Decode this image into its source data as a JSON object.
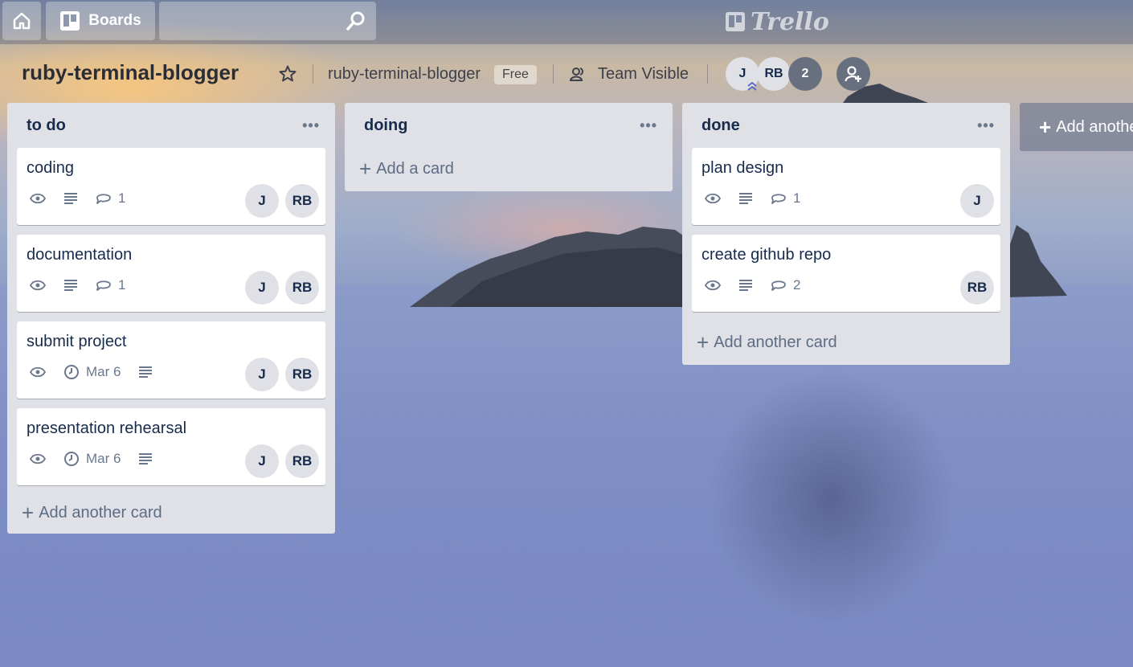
{
  "header": {
    "boards_label": "Boards",
    "search_placeholder": "",
    "logo_text": "Trello"
  },
  "board": {
    "title": "ruby-terminal-blogger",
    "team_name": "ruby-terminal-blogger",
    "plan_badge": "Free",
    "visibility": "Team Visible",
    "members": [
      "J",
      "RB"
    ],
    "extra_member_count": "2"
  },
  "lists": [
    {
      "title": "to do",
      "menu": "•••",
      "cards": [
        {
          "title": "coding",
          "comments": "1",
          "members": [
            "J",
            "RB"
          ]
        },
        {
          "title": "documentation",
          "comments": "1",
          "members": [
            "J",
            "RB"
          ]
        },
        {
          "title": "submit project",
          "due": "Mar 6",
          "members": [
            "J",
            "RB"
          ]
        },
        {
          "title": "presentation rehearsal",
          "due": "Mar 6",
          "members": [
            "J",
            "RB"
          ]
        }
      ],
      "add_label": "Add another card"
    },
    {
      "title": "doing",
      "menu": "•••",
      "cards": [],
      "add_label": "Add a card"
    },
    {
      "title": "done",
      "menu": "•••",
      "cards": [
        {
          "title": "plan design",
          "comments": "1",
          "members": [
            "J"
          ]
        },
        {
          "title": "create github repo",
          "comments": "2",
          "members": [
            "RB"
          ]
        }
      ],
      "add_label": "Add another card"
    }
  ],
  "add_list_label": "Add another list",
  "icons": {
    "home": "home-icon",
    "boards": "boards-icon",
    "search": "search-icon",
    "star": "star-icon",
    "visibility": "team-icon",
    "watch": "eye-icon",
    "description": "description-icon",
    "comment": "comment-icon",
    "due": "clock-icon",
    "invite": "add-member-icon"
  }
}
